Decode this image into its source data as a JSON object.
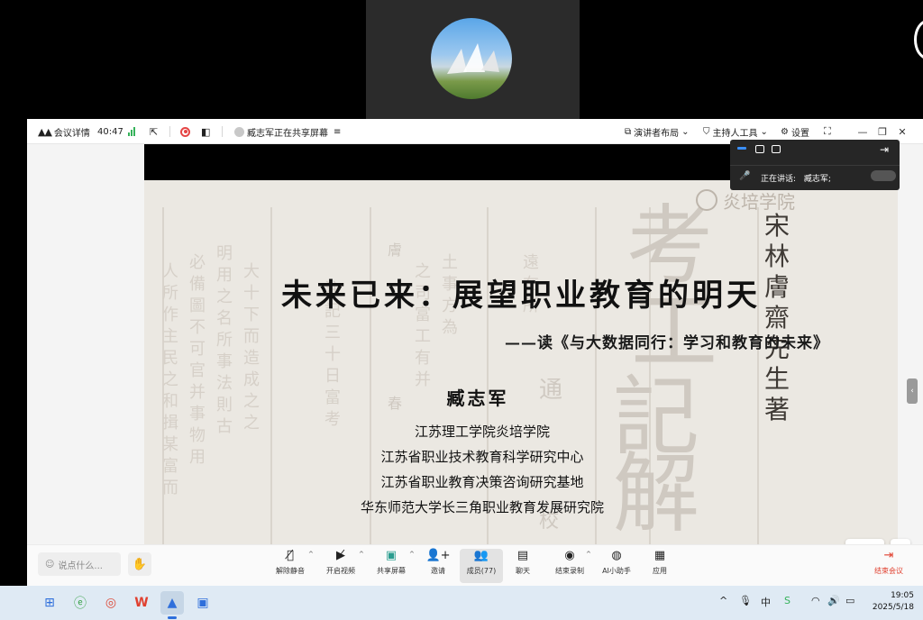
{
  "meeting": {
    "details_label": "会议详情",
    "duration": "40:47",
    "sharing_status": "臧志军正在共享屏幕",
    "layout_label": "演讲者布局",
    "host_tools_label": "主持人工具",
    "settings_label": "设置"
  },
  "speaker_panel": {
    "speaking_label": "正在讲话:",
    "speaker_name": "臧志军;"
  },
  "slide": {
    "watermark": "炎培学院",
    "title": "未来已来：展望职业教育的明天",
    "subtitle": "——读《与大数据同行：学习和教育的未来》",
    "author": "臧志军",
    "affiliations": [
      "江苏理工学院炎培学院",
      "江苏省职业技术教育科学研究中心",
      "江苏省职业教育决策咨询研究基地",
      "华东师范大学长三角职业教育发展研究院"
    ],
    "background_big_chars": [
      "考",
      "工",
      "記",
      "解"
    ],
    "background_author_chars": "宋林膚齋先生著",
    "background_small_chars": [
      "通",
      "膚",
      "春",
      "校"
    ]
  },
  "stage_tools": {
    "annotate_label": "批注"
  },
  "toolbar": {
    "chat_placeholder": "说点什么...",
    "buttons": {
      "unmute": "解除静音",
      "start_video": "开启视频",
      "share_screen": "共享屏幕",
      "invite": "邀请",
      "members": "成员(77)",
      "chat": "聊天",
      "end_recording": "结束录制",
      "ai_assistant": "AI小助手",
      "apps": "应用"
    },
    "end_meeting": "结束会议"
  },
  "taskbar": {
    "time": "19:05",
    "date": "2025/5/18",
    "ime": "中"
  },
  "colors": {
    "accent_blue": "#3a8ef6",
    "danger_red": "#e0402f",
    "signal_green": "#35b25a"
  },
  "icons": [
    "meeting-logo-icon",
    "signal-icon",
    "external-link-icon",
    "record-icon",
    "share-status-icon",
    "layout-icon",
    "shield-icon",
    "gear-icon",
    "fullscreen-icon",
    "minimize-icon",
    "restore-icon",
    "close-icon",
    "mic-off-icon",
    "video-off-icon",
    "share-screen-icon",
    "invite-icon",
    "members-icon",
    "chat-icon",
    "record-stop-icon",
    "ai-assistant-icon",
    "apps-icon",
    "exit-icon",
    "hand-icon",
    "smiley-icon",
    "pencil-icon",
    "zoom-icon",
    "windows-start-icon",
    "edge-icon",
    "chrome-icon",
    "wps-icon",
    "meeting-app-icon",
    "app-icon"
  ]
}
